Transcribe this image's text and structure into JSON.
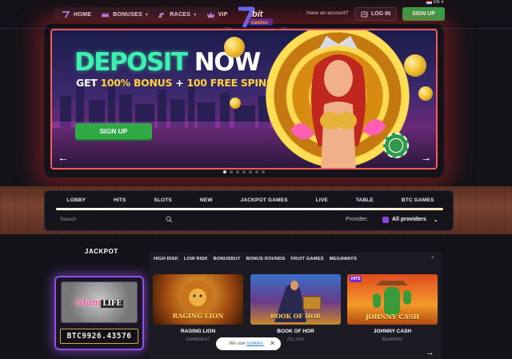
{
  "nav": {
    "items": [
      {
        "label": "HOME",
        "icon": "seven-icon",
        "has_menu": false
      },
      {
        "label": "BONUSES",
        "icon": "crown-icon",
        "has_menu": true
      },
      {
        "label": "RACES",
        "icon": "horse-icon",
        "has_menu": true
      },
      {
        "label": "VIP",
        "icon": "vip-crown-icon",
        "has_menu": false
      }
    ],
    "have_account": "Have an account?",
    "login_label": "LOG IN",
    "signup_label": "SIGN UP",
    "language": "EN"
  },
  "logo": {
    "text": "7bit casino"
  },
  "hero": {
    "title_part1": "DEPOSIT",
    "title_part2": "NOW",
    "subtitle_part1": "GET ",
    "subtitle_highlight1": "100% BONUS",
    "subtitle_mid": " + ",
    "subtitle_highlight2": "100 FREE SPINS",
    "cta_label": "SIGN UP",
    "slide_count": 7,
    "active_slide": 0
  },
  "categories": {
    "tabs": [
      "LOBBY",
      "HITS",
      "SLOTS",
      "NEW",
      "JACKPOT GAMES",
      "LIVE",
      "TABLE",
      "BTC GAMES"
    ],
    "search_placeholder": "Search",
    "provider_label": "Provider:",
    "provider_value": "All providers"
  },
  "jackpot": {
    "title": "JACKPOT",
    "game_logo_word1": "Glam",
    "game_logo_word2": "LIFE",
    "value": "BTC9926.43576"
  },
  "games": {
    "filters": [
      "HIGH RISK",
      "LOW RISK",
      "BONUSBUY",
      "BONUS ROUNDS",
      "FRUIT GAMES",
      "MEGAWAYS"
    ],
    "tiles": [
      {
        "title": "RAGING LION",
        "provider": "GAMEBEAT",
        "art_text": "RAGING LION",
        "badge": ""
      },
      {
        "title": "BOOK OF HOR",
        "provider": "ZILLION",
        "art_text": "BOOK OF HOR",
        "badge": ""
      },
      {
        "title": "JOHNNY CASH",
        "provider": "BGAMING",
        "art_text": "JOHNNY CASH",
        "badge": "HITS"
      }
    ]
  },
  "cookie": {
    "text": "We use",
    "link": "cookies."
  },
  "colors": {
    "accent_green": "#27a64a",
    "hero_border": "#ff5656",
    "jackpot_glow": "#8f4ee8",
    "title_teal": "#3ef0b0",
    "highlight_yellow": "#ffd23e"
  }
}
